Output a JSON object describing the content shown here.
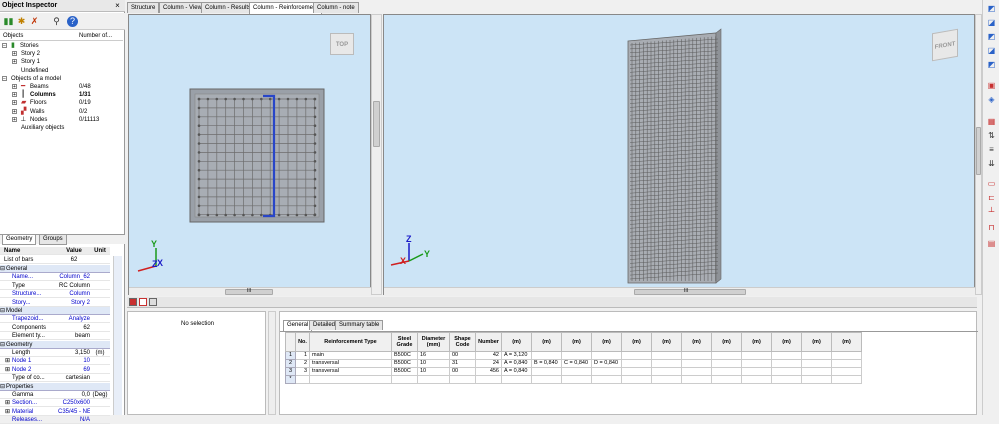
{
  "inspector": {
    "title": "Object Inspector",
    "close": "×",
    "toolbar_icons": [
      "filter-green-icon",
      "filter-star-icon",
      "filter-x-icon",
      "search-icon",
      "help-icon"
    ],
    "tree_header": {
      "objects": "Objects",
      "number": "Number of..."
    },
    "tree": [
      {
        "label": "Stories",
        "count": "",
        "indent": 0,
        "expander": "−",
        "icon": "stories-icon"
      },
      {
        "label": "Story 2",
        "count": "",
        "indent": 1,
        "expander": "+",
        "icon": ""
      },
      {
        "label": "Story 1",
        "count": "",
        "indent": 1,
        "expander": "+",
        "icon": ""
      },
      {
        "label": "Undefined",
        "count": "",
        "indent": 1,
        "expander": "",
        "icon": ""
      },
      {
        "label": "Objects of a model",
        "count": "",
        "indent": 0,
        "expander": "−",
        "icon": ""
      },
      {
        "label": "Beams",
        "count": "0/48",
        "indent": 1,
        "expander": "+",
        "icon": "beam-icon"
      },
      {
        "label": "Columns",
        "count": "1/31",
        "indent": 1,
        "expander": "+",
        "icon": "column-icon",
        "bold": true
      },
      {
        "label": "Floors",
        "count": "0/19",
        "indent": 1,
        "expander": "+",
        "icon": "floor-icon"
      },
      {
        "label": "Walls",
        "count": "0/2",
        "indent": 1,
        "expander": "+",
        "icon": "wall-icon"
      },
      {
        "label": "Nodes",
        "count": "0/11113",
        "indent": 1,
        "expander": "+",
        "icon": "node-icon"
      },
      {
        "label": "Auxiliary objects",
        "count": "",
        "indent": 1,
        "expander": "",
        "icon": ""
      }
    ],
    "tabs": [
      "Geometry",
      "Groups"
    ],
    "grid_header": {
      "name": "Name",
      "value": "Value",
      "unit": "Unit"
    },
    "list_of_bars": {
      "name": "List of bars",
      "value": "62"
    },
    "sections": [
      {
        "title": "General",
        "rows": [
          {
            "name": "Name...",
            "value": "Column_62",
            "unit": "",
            "blue": true
          },
          {
            "name": "Type",
            "value": "RC Column",
            "unit": ""
          },
          {
            "name": "Structure...",
            "value": "Column",
            "unit": "",
            "blue": true
          },
          {
            "name": "Story...",
            "value": "Story 2",
            "unit": "",
            "blue": true
          }
        ]
      },
      {
        "title": "Model",
        "rows": [
          {
            "name": "Trapezoid...",
            "value": "Analyze",
            "unit": "",
            "blue": true
          },
          {
            "name": "Components",
            "value": "62",
            "unit": ""
          },
          {
            "name": "Element ty...",
            "value": "beam",
            "unit": ""
          }
        ]
      },
      {
        "title": "Geometry",
        "rows": [
          {
            "name": "Length",
            "value": "3,150",
            "unit": "(m)"
          },
          {
            "name": "Node 1",
            "value": "10",
            "unit": "",
            "blue": true,
            "expander": true
          },
          {
            "name": "Node 2",
            "value": "69",
            "unit": "",
            "blue": true,
            "expander": true
          },
          {
            "name": "Type of co...",
            "value": "cartesian",
            "unit": ""
          }
        ]
      },
      {
        "title": "Properties",
        "rows": [
          {
            "name": "Gamma",
            "value": "0,0",
            "unit": "(Deg)"
          },
          {
            "name": "Section...",
            "value": "C250x600",
            "unit": "",
            "blue": true,
            "expander": true
          },
          {
            "name": "Material",
            "value": "C35/45 - NEW",
            "unit": "",
            "blue": true,
            "expander": true
          },
          {
            "name": "Releases...",
            "value": "N/A",
            "unit": "",
            "blue": true
          }
        ]
      }
    ]
  },
  "view_tabs": [
    {
      "label": "Structure",
      "active": false
    },
    {
      "label": "Column - View",
      "active": false
    },
    {
      "label": "Column - Results",
      "active": false
    },
    {
      "label": "Column - Reinforcement",
      "active": true
    },
    {
      "label": "Column - note",
      "active": false
    }
  ],
  "viewport_left": {
    "cube_label": "TOP",
    "scroll_label": "III"
  },
  "viewport_right": {
    "cube_label": "FRONT",
    "scroll_label": "III"
  },
  "no_selection": "No selection",
  "bottom_tabs": [
    {
      "label": "General",
      "active": true
    },
    {
      "label": "Detailed",
      "active": false
    },
    {
      "label": "Summary table",
      "active": false
    }
  ],
  "table": {
    "headers": [
      "No.",
      "Reinforcement Type",
      "Steel Grade",
      "Diameter (mm)",
      "Shape Code",
      "Number",
      "(m)",
      "(m)",
      "(m)",
      "(m)",
      "(m)",
      "(m)",
      "(m)",
      "(m)",
      "(m)",
      "(m)",
      "(m)",
      "(m)"
    ],
    "rows": [
      {
        "rh": "1",
        "cells": [
          "1",
          "main",
          "B500C",
          "16",
          "00",
          "42",
          "A = 3,120",
          "",
          "",
          "",
          "",
          "",
          "",
          "",
          "",
          "",
          "",
          ""
        ]
      },
      {
        "rh": "2",
        "cells": [
          "2",
          "transversal",
          "B500C",
          "10",
          "31",
          "24",
          "A = 0,840",
          "B = 0,840",
          "C = 0,840",
          "D = 0,840",
          "",
          "",
          "",
          "",
          "",
          "",
          "",
          ""
        ]
      },
      {
        "rh": "3",
        "cells": [
          "3",
          "transversal",
          "B500C",
          "10",
          "00",
          "456",
          "A = 0,840",
          "",
          "",
          "",
          "",
          "",
          "",
          "",
          "",
          "",
          "",
          ""
        ]
      },
      {
        "rh": "*",
        "cells": [
          "",
          "",
          "",
          "",
          "",
          "",
          "",
          "",
          "",
          "",
          "",
          "",
          "",
          "",
          "",
          "",
          "",
          ""
        ]
      }
    ]
  },
  "colors": {
    "viewport_bg": "#cce4f6",
    "rebar": "#6b6b6b",
    "stirrup": "#2846c8",
    "section_header": "#dfe8f6"
  }
}
